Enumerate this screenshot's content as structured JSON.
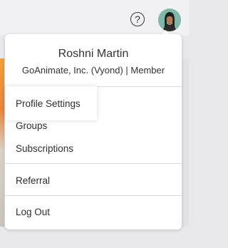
{
  "topbar": {
    "help_icon": "question-circle-icon",
    "help_glyph": "?",
    "avatar_icon": "user-avatar-icon"
  },
  "menu": {
    "user_name": "Roshni Martin",
    "user_org": "GoAnimate, Inc. (Vyond) | Member",
    "items": [
      {
        "label": "Profile Settings"
      },
      {
        "label": "Groups"
      },
      {
        "label": "Subscriptions"
      },
      {
        "label": "Referral"
      },
      {
        "label": "Log Out"
      }
    ]
  },
  "colors": {
    "page_bg": "#e9e9ec",
    "menu_bg": "#ffffff",
    "text": "#2e2e2e",
    "divider": "#dcdcdc",
    "avatar_bg": "#7fb7a9"
  }
}
